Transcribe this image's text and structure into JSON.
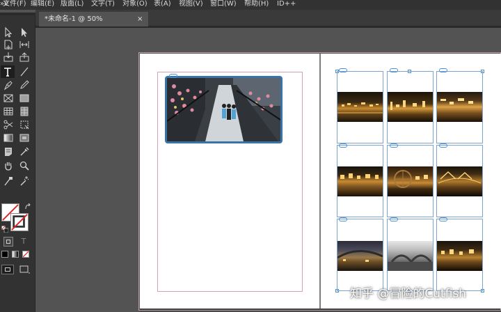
{
  "menu": {
    "items": [
      "文件(F)",
      "编辑(E)",
      "版面(L)",
      "文字(T)",
      "对象(O)",
      "表(A)",
      "视图(V)",
      "窗口(W)",
      "帮助(H)",
      "ID++"
    ],
    "left_fragment": "»e"
  },
  "tabs": [
    {
      "label": "*未命名-1 @ 50%",
      "close": "×"
    }
  ],
  "tools": [
    "selection-tool",
    "direct-selection-tool",
    "page-tool",
    "gap-tool",
    "content-collector-tool",
    "content-placer-tool",
    "type-tool",
    "line-tool",
    "pen-tool",
    "pencil-tool",
    "rectangle-frame-tool",
    "rectangle-tool",
    "table-tool",
    "grid-tool",
    "scissors-tool",
    "free-transform-tool",
    "gradient-swatch-tool",
    "gradient-feather-tool",
    "note-tool",
    "eyedropper-tool",
    "hand-tool",
    "zoom-tool",
    "color-theme-tool",
    "magic-wand-tool"
  ],
  "swatch": {
    "default_colors_label": "",
    "text_mode_label": "T"
  },
  "watermark": "知乎 @冒险的Cutfish"
}
